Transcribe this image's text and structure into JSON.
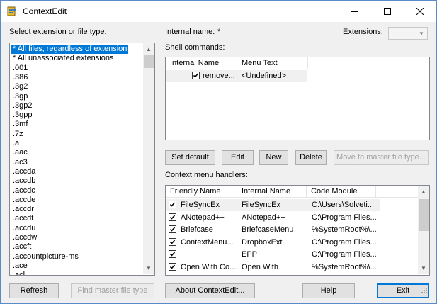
{
  "window": {
    "title": "ContextEdit"
  },
  "left": {
    "label": "Select extension or file type:",
    "items": [
      "* All files, regardless of extension",
      "* All unassociated extensions",
      ".001",
      ".386",
      ".3g2",
      ".3gp",
      ".3gp2",
      ".3gpp",
      ".3mf",
      ".7z",
      ".a",
      ".aac",
      ".ac3",
      ".accda",
      ".accdb",
      ".accdc",
      ".accde",
      ".accdr",
      ".accdt",
      ".accdu",
      ".accdw",
      ".accft",
      ".accountpicture-ms",
      ".ace",
      ".acl"
    ],
    "selected_index": 0
  },
  "internal_name": {
    "label": "Internal name:",
    "value": "*"
  },
  "extensions": {
    "label": "Extensions:",
    "value": ""
  },
  "shell": {
    "label": "Shell commands:",
    "columns": [
      "Internal Name",
      "Menu Text"
    ],
    "rows": [
      {
        "checked": true,
        "internal": "remove...",
        "menu": "<Undefined>"
      }
    ],
    "buttons": {
      "set_default": "Set default",
      "edit": "Edit",
      "new": "New",
      "delete": "Delete",
      "move": "Move to master file type..."
    }
  },
  "handlers": {
    "label": "Context menu handlers:",
    "columns": [
      "Friendly Name",
      "Internal Name",
      "Code Module"
    ],
    "rows": [
      {
        "checked": true,
        "friendly": "FileSyncEx",
        "internal": "FileSyncEx",
        "module": "C:\\Users\\Solveti..."
      },
      {
        "checked": true,
        "friendly": "ANotepad++",
        "internal": "ANotepad++",
        "module": "C:\\Program Files..."
      },
      {
        "checked": true,
        "friendly": "Briefcase",
        "internal": "BriefcaseMenu",
        "module": "%SystemRoot%\\..."
      },
      {
        "checked": true,
        "friendly": "ContextMenu...",
        "internal": "DropboxExt",
        "module": "C:\\Program Files..."
      },
      {
        "checked": true,
        "friendly": "",
        "internal": "EPP",
        "module": "C:\\Program Files..."
      },
      {
        "checked": true,
        "friendly": "Open With Co...",
        "internal": "Open With",
        "module": "%SystemRoot%\\..."
      }
    ]
  },
  "bottom": {
    "refresh": "Refresh",
    "find_master": "Find master file type",
    "about": "About ContextEdit...",
    "help": "Help",
    "exit": "Exit"
  }
}
